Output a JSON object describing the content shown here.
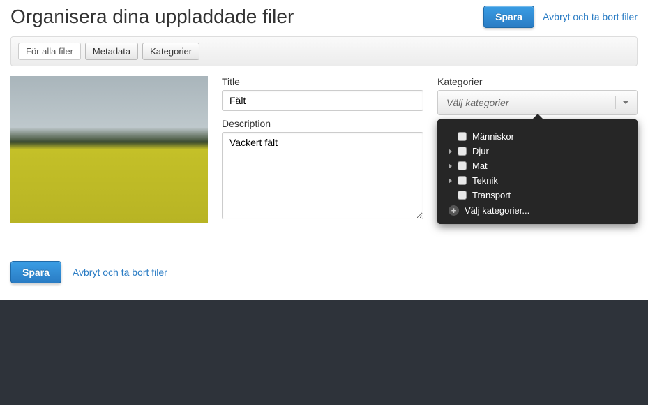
{
  "header": {
    "title": "Organisera dina uppladdade filer",
    "save_label": "Spara",
    "cancel_label": "Avbryt och ta bort filer"
  },
  "toolbar": {
    "all_files_label": "För alla filer",
    "metadata_label": "Metadata",
    "categories_label": "Kategorier"
  },
  "form": {
    "title_label": "Title",
    "title_value": "Fält",
    "description_label": "Description",
    "description_value": "Vackert fält"
  },
  "categories": {
    "label": "Kategorier",
    "placeholder": "Välj kategorier",
    "items": [
      {
        "label": "Människor",
        "expandable": false
      },
      {
        "label": "Djur",
        "expandable": true
      },
      {
        "label": "Mat",
        "expandable": true
      },
      {
        "label": "Teknik",
        "expandable": true
      },
      {
        "label": "Transport",
        "expandable": false
      }
    ],
    "add_label": "Välj kategorier..."
  },
  "footer": {
    "save_label": "Spara",
    "cancel_label": "Avbryt och ta bort filer"
  }
}
